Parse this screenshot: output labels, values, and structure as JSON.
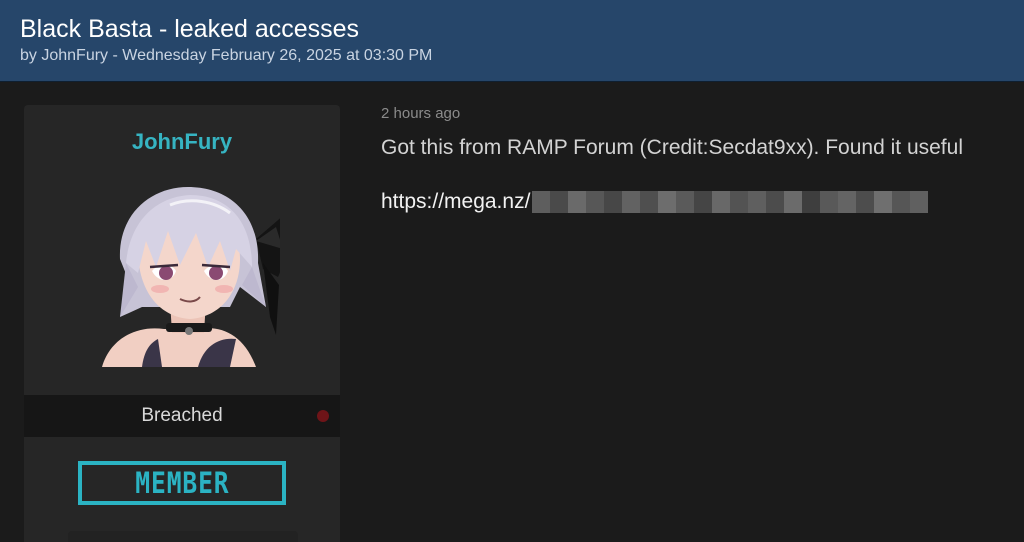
{
  "thread": {
    "title": "Black Basta - leaked accesses",
    "meta": "by JohnFury - Wednesday February 26, 2025 at 03:30 PM"
  },
  "user": {
    "username": "JohnFury",
    "group": "Breached",
    "rank": "MEMBER"
  },
  "post": {
    "time": "2 hours ago",
    "body": "Got this from RAMP Forum (Credit:Secdat9xx). Found it useful",
    "link_text": "https://mega.nz/"
  },
  "colors": {
    "header_bg": "#26466a",
    "accent": "#2bb3c3",
    "username": "#36b4c2",
    "status_dot": "#6e1418"
  }
}
